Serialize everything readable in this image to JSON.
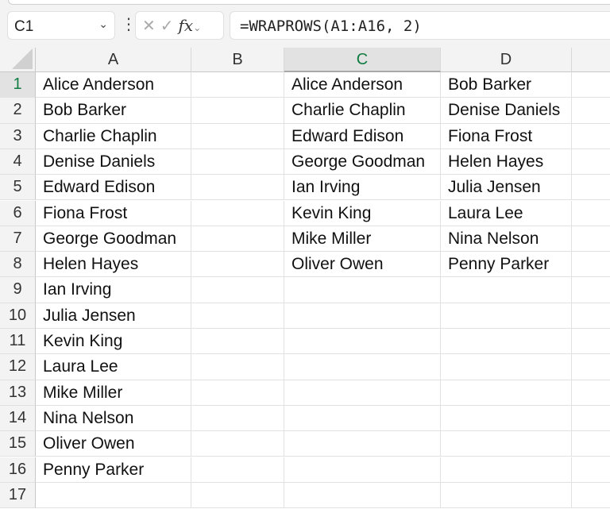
{
  "name_box": {
    "value": "C1"
  },
  "formula_bar": {
    "value": "=WRAPROWS(A1:A16, 2)",
    "fx_label": "fx"
  },
  "columns": [
    "A",
    "B",
    "C",
    "D"
  ],
  "selected_column": "C",
  "selected_row": 1,
  "rows": [
    1,
    2,
    3,
    4,
    5,
    6,
    7,
    8,
    9,
    10,
    11,
    12,
    13,
    14,
    15,
    16,
    17
  ],
  "column_a": [
    "Alice Anderson",
    "Bob Barker",
    "Charlie Chaplin",
    "Denise Daniels",
    "Edward Edison",
    "Fiona Frost",
    "George Goodman",
    "Helen Hayes",
    "Ian Irving",
    "Julia Jensen",
    "Kevin King",
    "Laura Lee",
    "Mike Miller",
    "Nina Nelson",
    "Oliver Owen",
    "Penny Parker"
  ],
  "column_c": [
    "Alice Anderson",
    "Charlie Chaplin",
    "Edward Edison",
    "George Goodman",
    "Ian Irving",
    "Kevin King",
    "Mike Miller",
    "Oliver Owen"
  ],
  "column_d": [
    "Bob Barker",
    "Denise Daniels",
    "Fiona Frost",
    "Helen Hayes",
    "Julia Jensen",
    "Laura Lee",
    "Nina Nelson",
    "Penny Parker"
  ]
}
